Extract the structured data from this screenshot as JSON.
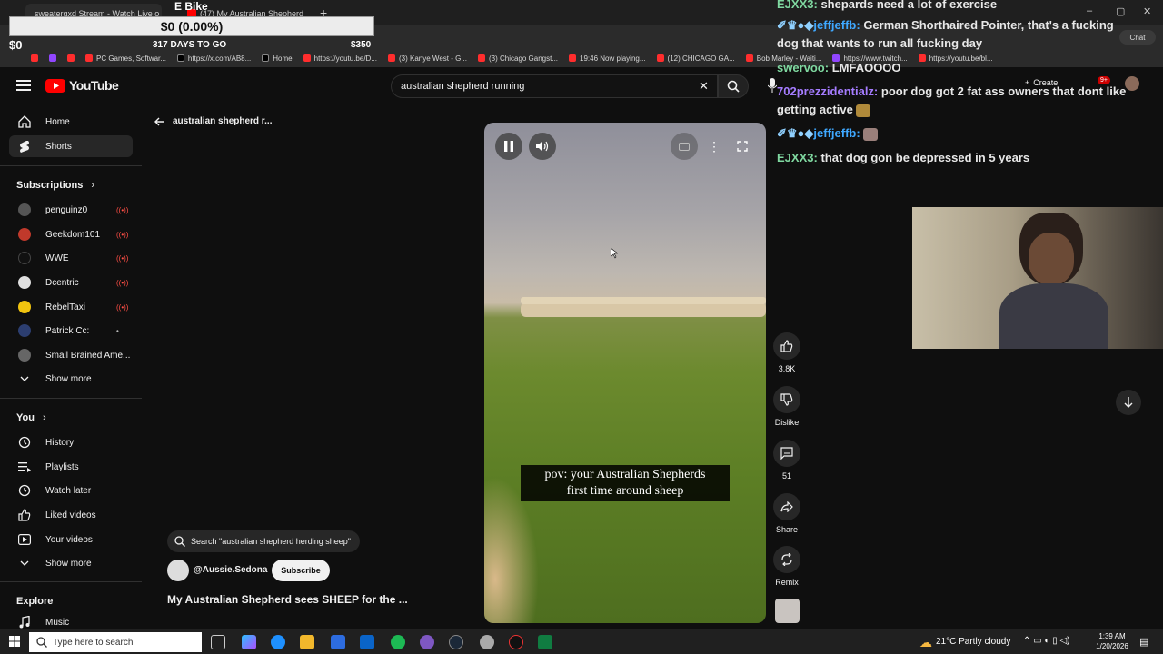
{
  "browser": {
    "tabs": [
      {
        "label": "sweatergxd Stream - Watch Live o"
      },
      {
        "label": "(47) My Australian Shepherd"
      }
    ],
    "bookmarks": [
      "PC Games, Softwar...",
      "https://x.com/AB8...",
      "Home",
      "https://youtu.be/D...",
      "(3) Kanye West - G...",
      "(3) Chicago Gangst...",
      "19:46 Now playing...",
      "(12) CHICAGO GA...",
      "Bob Marley - Waiti...",
      "https://www.twitch...",
      "https://youtu.be/bl..."
    ]
  },
  "overlay": {
    "title": "E Bike",
    "progress_text": "$0 (0.00%)",
    "raised": "$0",
    "days_left": "317 DAYS TO GO",
    "goal": "$350"
  },
  "youtube": {
    "brand": "YouTube",
    "search_value": "australian shepherd running",
    "back_label": "australian shepherd r...",
    "create_label": "Create",
    "notif_count": "9+",
    "sidebar": {
      "home": "Home",
      "shorts": "Shorts",
      "subscriptions_header": "Subscriptions",
      "subscriptions": [
        {
          "name": "penguinz0",
          "color": "#555555"
        },
        {
          "name": "Geekdom101",
          "color": "#c0392b"
        },
        {
          "name": "WWE",
          "color": "#111111"
        },
        {
          "name": "Dcentric",
          "color": "#e0e0e0"
        },
        {
          "name": "RebelTaxi",
          "color": "#f1c40f"
        },
        {
          "name": "Patrick Cc:",
          "color": "#2c3e70"
        },
        {
          "name": "Small Brained Ame...",
          "color": "#666666"
        }
      ],
      "show_more_1": "Show more",
      "you_header": "You",
      "you_items": [
        "History",
        "Playlists",
        "Watch later",
        "Liked videos",
        "Your videos"
      ],
      "show_more_2": "Show more",
      "explore_header": "Explore",
      "music": "Music"
    },
    "short": {
      "caption_line1": "pov: your Australian Shepherds",
      "caption_line2": "first time around sheep",
      "search_suggestion": "Search \"australian shepherd herding sheep\"",
      "channel": "@Aussie.Sedona",
      "subscribe": "Subscribe",
      "title": "My Australian Shepherd sees SHEEP for the ..."
    },
    "actions": {
      "likes": "3.8K",
      "dislike": "Dislike",
      "comments": "51",
      "share": "Share",
      "remix": "Remix"
    }
  },
  "chat": {
    "header_label": "Chat",
    "messages": [
      {
        "user": "EJXX3:",
        "text": "shepards need a lot of exercise",
        "color": "green"
      },
      {
        "user": "jeffjeffb:",
        "text": "German Shorthaired Pointer, that's a fucking",
        "color": "blue"
      },
      {
        "user": "",
        "text": "dog that wants to run all fucking day",
        "color": "none"
      },
      {
        "user": "swervoo:",
        "text": "LMFAOOOO",
        "color": "green"
      },
      {
        "user": "702prezzidentialz:",
        "text": "poor dog got 2 fat ass owners that dont like",
        "color": "purple"
      },
      {
        "user": "",
        "text": "getting active",
        "color": "none"
      },
      {
        "user": "jeffjeffb:",
        "text": "",
        "color": "blue"
      },
      {
        "user": "EJXX3:",
        "text": "that dog gon be depressed in 5 years",
        "color": "green"
      }
    ]
  },
  "taskbar": {
    "search_placeholder": "Type here to search",
    "weather": "21°C  Partly cloudy",
    "time": "1:39 AM",
    "date": "1/20/2026"
  }
}
